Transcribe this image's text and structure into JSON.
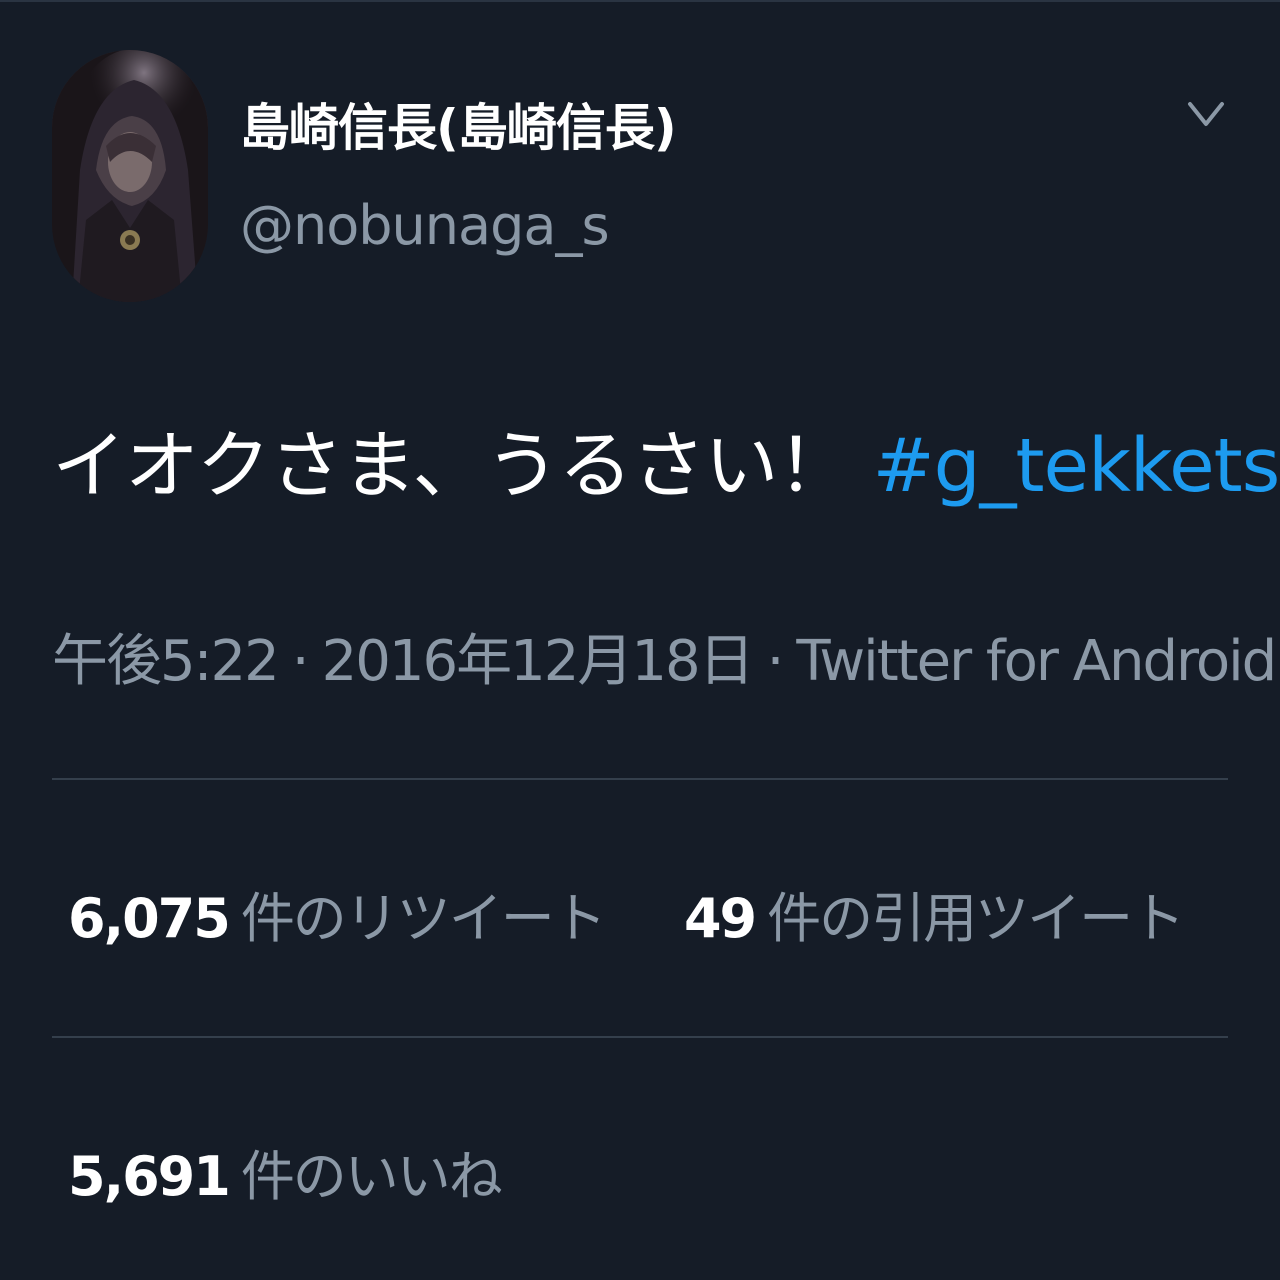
{
  "author": {
    "display_name": "島崎信長(島崎信長)",
    "handle": "@nobunaga_s",
    "avatar_icon": "user-avatar"
  },
  "menu": {
    "icon": "chevron-down-icon"
  },
  "tweet": {
    "text": "イオクさま、うるさい！",
    "hashtag": "#g_tekketsu"
  },
  "meta": {
    "time": "午後5:22",
    "separator": "·",
    "date": "2016年12月18日",
    "source": "Twitter for Android"
  },
  "stats": {
    "retweets": {
      "count": "6,075",
      "label": "件のリツイート"
    },
    "quotes": {
      "count": "49",
      "label": "件の引用ツイート"
    },
    "likes": {
      "count": "5,691",
      "label": "件のいいね"
    }
  },
  "colors": {
    "background": "#151c27",
    "text": "#ffffff",
    "secondary": "#8b98a6",
    "link": "#1d9bf0",
    "divider": "#343f4c"
  }
}
